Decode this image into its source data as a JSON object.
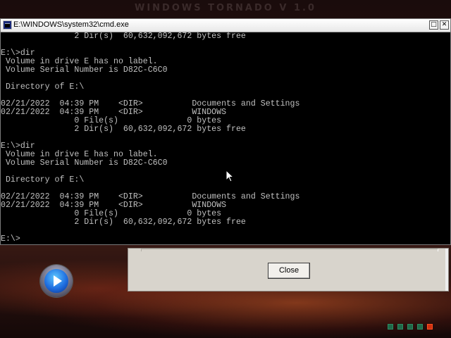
{
  "desktop": {
    "brand_text": "WINDOWS TORNADO V 1.0"
  },
  "cmd_window": {
    "title": "E:\\WINDOWS\\system32\\cmd.exe",
    "maximize_glyph": "□",
    "close_glyph": "✕",
    "lines": [
      "               2 Dir(s)  60,632,092,672 bytes free",
      "",
      "E:\\>dir",
      " Volume in drive E has no label.",
      " Volume Serial Number is D82C-C6C0",
      "",
      " Directory of E:\\",
      "",
      "02/21/2022  04:39 PM    <DIR>          Documents and Settings",
      "02/21/2022  04:39 PM    <DIR>          WINDOWS",
      "               0 File(s)              0 bytes",
      "               2 Dir(s)  60,632,092,672 bytes free",
      "",
      "E:\\>dir",
      " Volume in drive E has no label.",
      " Volume Serial Number is D82C-C6C0",
      "",
      " Directory of E:\\",
      "",
      "02/21/2022  04:39 PM    <DIR>          Documents and Settings",
      "02/21/2022  04:39 PM    <DIR>          WINDOWS",
      "               0 File(s)              0 bytes",
      "               2 Dir(s)  60,632,092,672 bytes free",
      "",
      "E:\\>"
    ]
  },
  "dialog": {
    "close_label": "Close"
  },
  "colors": {
    "console_bg": "#000000",
    "console_text": "#c0c0c0",
    "tray_green": "#1f6a4a",
    "tray_red": "#d03010"
  },
  "icons": {
    "media": "media-player-icon",
    "cmd": "cmd-icon"
  }
}
